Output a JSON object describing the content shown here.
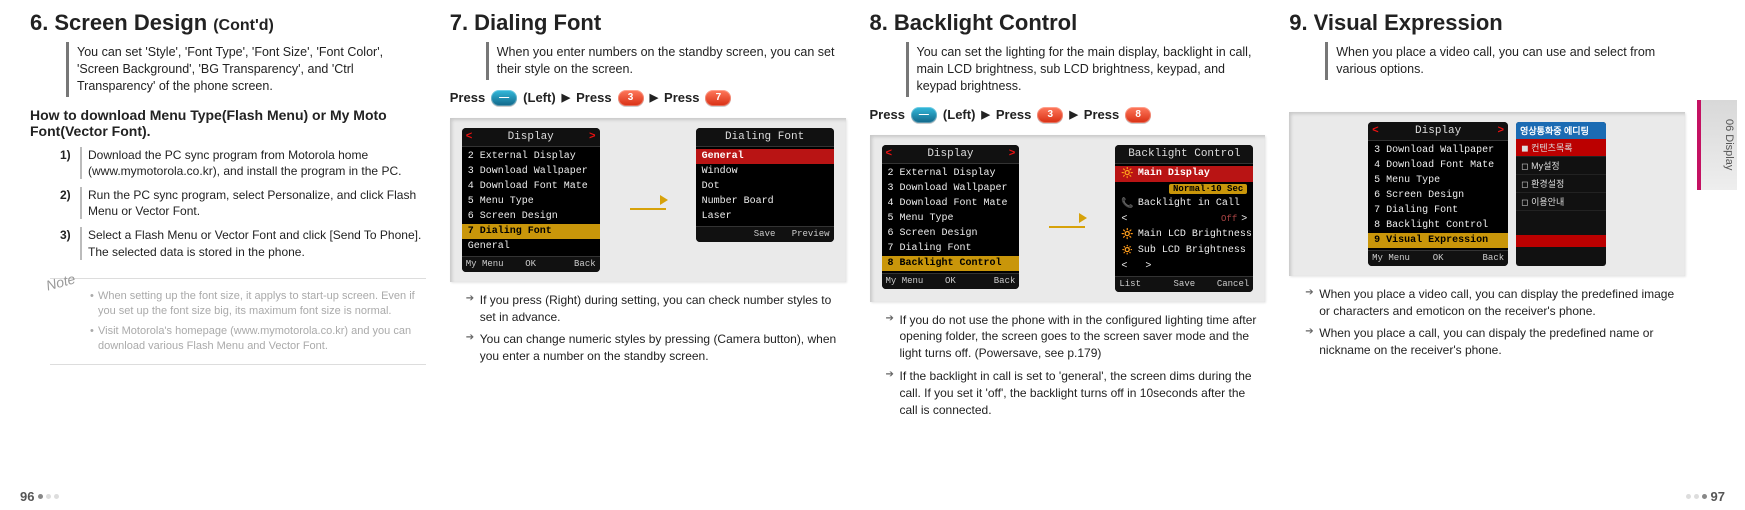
{
  "tab_label": "06  Display",
  "page_left": "96",
  "page_right": "97",
  "sec6": {
    "num": "6.",
    "title": "Screen Design",
    "suffix": "(Cont'd)",
    "intro": "You can set 'Style', 'Font Type', 'Font Size', 'Font Color', 'Screen Background', 'BG Transparency', and 'Ctrl Transparency' of the phone screen.",
    "subhead": "How to download Menu Type(Flash Menu) or My Moto Font(Vector Font).",
    "steps": [
      "Download the PC sync program from Motorola home (www.mymotorola.co.kr), and install the program in the PC.",
      "Run the PC sync program, select Personalize, and click Flash Menu or Vector Font.",
      "Select a Flash Menu or Vector Font and click [Send To Phone]. The selected data is stored in the phone."
    ],
    "note_label": "Note",
    "notes": [
      "When setting up the font size, it applys to start-up screen. Even if you set up the font size big, its maximum font size is normal.",
      "Visit Motorola's homepage (www.mymotorola.co.kr) and you can download various Flash Menu and Vector Font."
    ]
  },
  "sec7": {
    "num": "7.",
    "title": "Dialing Font",
    "intro": "When you enter numbers on the standby screen, you can set their style on the screen.",
    "press": {
      "press": "Press",
      "left": "(Left)",
      "k1": "—",
      "k2": "3",
      "k3": "7"
    },
    "phoneA": {
      "title": "Display",
      "items": [
        "2 External Display",
        "3 Download Wallpaper",
        "4 Download Font Mate",
        "5 Menu Type",
        "6 Screen Design",
        "7 Dialing Font"
      ],
      "subrow": "General",
      "soft": [
        "My Menu",
        "OK",
        "Back"
      ]
    },
    "phoneB": {
      "title": "Dialing Font",
      "items": [
        "General",
        "Window",
        "Dot",
        "Number Board",
        "Laser"
      ],
      "soft": [
        "",
        "Save",
        "Preview"
      ]
    },
    "bullets": [
      "If you press        (Right) during setting, you can check number styles to set in advance.",
      "You can change numeric styles by pressing              (Camera button), when you enter a number on the standby screen."
    ]
  },
  "sec8": {
    "num": "8.",
    "title": "Backlight Control",
    "intro": "You can set the lighting for the main display, backlight in call, main LCD brightness, sub LCD brightness, keypad, and keypad brightness.",
    "press": {
      "press": "Press",
      "left": "(Left)",
      "k1": "—",
      "k2": "3",
      "k3": "8"
    },
    "phoneA": {
      "title": "Display",
      "items": [
        "2 External Display",
        "3 Download Wallpaper",
        "4 Download Font Mate",
        "5 Menu Type",
        "6 Screen Design",
        "7 Dialing Font",
        "8 Backlight Control"
      ],
      "soft": [
        "My Menu",
        "OK",
        "Back"
      ]
    },
    "phoneB": {
      "title": "Backlight Control",
      "rows": [
        {
          "label": "Main Display",
          "val": "Normal·10 Sec"
        },
        {
          "label": "Backlight in Call",
          "val": ""
        },
        {
          "label": "",
          "val": "Off"
        },
        {
          "label": "Main LCD Brightness",
          "val": ""
        },
        {
          "label": "Sub LCD Brightness",
          "val": ""
        },
        {
          "label": "",
          "val": ""
        }
      ],
      "soft": [
        "List",
        "Save",
        "Cancel"
      ]
    },
    "bullets": [
      "If you do not use the phone with in the configured lighting time after opening folder, the screen goes to the screen saver mode and the light turns off. (Powersave, see p.179)",
      "If the backlight in call is set to 'general', the screen dims during the call. If you set it 'off', the backlight turns off in 10seconds after the call is connected."
    ]
  },
  "sec9": {
    "num": "9.",
    "title": "Visual Expression",
    "intro": "When you place a video call, you can use and select from various options.",
    "phoneA": {
      "title": "Display",
      "items": [
        "3 Download Wallpaper",
        "4 Download Font Mate",
        "5 Menu Type",
        "6 Screen Design",
        "7 Dialing Font",
        "8 Backlight Control",
        "9 Visual Expression"
      ],
      "soft": [
        "My Menu",
        "OK",
        "Back"
      ]
    },
    "side": {
      "header": "영상통화중 에디팅",
      "opts": [
        "컨텐츠목록",
        "My설정",
        "환경설정",
        "이용안내"
      ]
    },
    "bullets": [
      "When you place a video call, you can display the predefined image or characters and emoticon on the receiver's phone.",
      "When you place a call, you can dispaly the predefined name or nickname on the receiver's phone."
    ]
  }
}
